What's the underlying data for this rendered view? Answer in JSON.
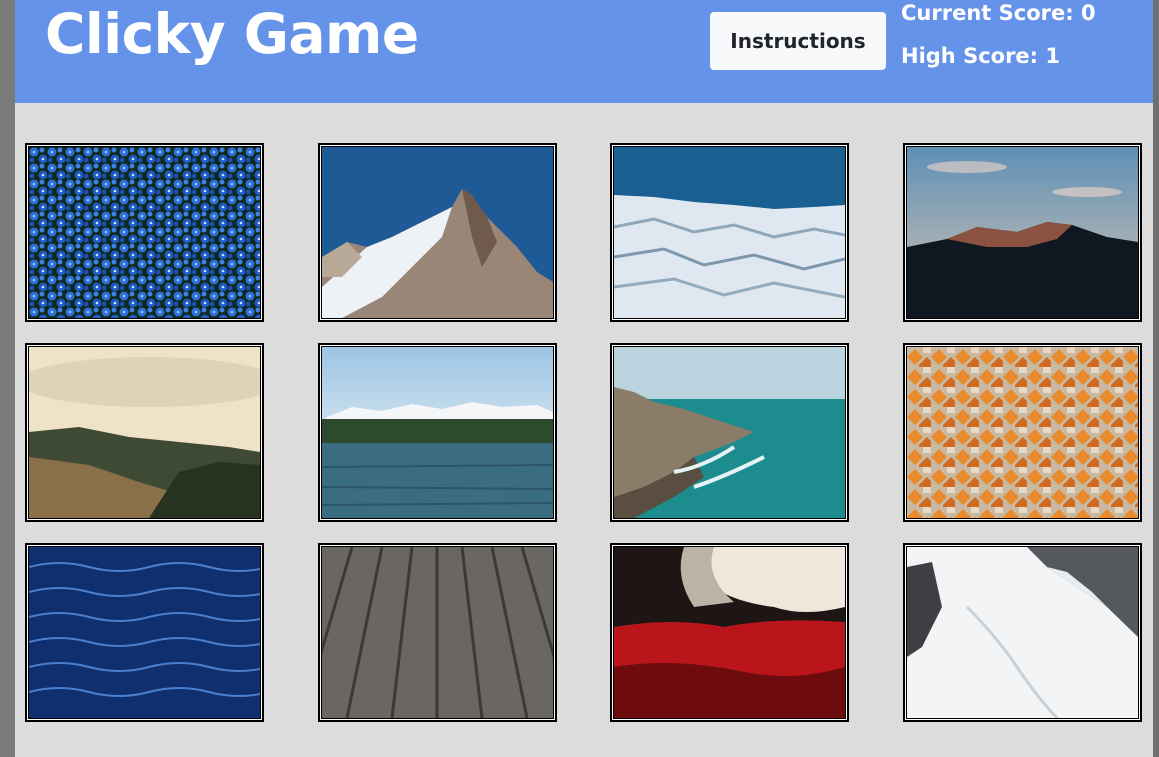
{
  "header": {
    "title": "Clicky Game",
    "instructions_label": "Instructions",
    "current_score_label": "Current Score:",
    "current_score": 0,
    "high_score_label": "High Score:",
    "high_score": 1
  },
  "colors": {
    "header_bg": "#6593e9",
    "page_bg": "#dcdcdc",
    "button_bg": "#f8f9fa"
  },
  "cards": [
    {
      "id": "card-1",
      "subject": "blue-flowers"
    },
    {
      "id": "card-2",
      "subject": "rocky-snow-peak"
    },
    {
      "id": "card-3",
      "subject": "glacier-ice"
    },
    {
      "id": "card-4",
      "subject": "mountain-ridge-dusk"
    },
    {
      "id": "card-5",
      "subject": "hazy-forest-hills"
    },
    {
      "id": "card-6",
      "subject": "lake-and-snowy-mountains"
    },
    {
      "id": "card-7",
      "subject": "rocky-coastline-sea"
    },
    {
      "id": "card-8",
      "subject": "orange-rooftops-city"
    },
    {
      "id": "card-9",
      "subject": "blue-water-ripples"
    },
    {
      "id": "card-10",
      "subject": "wooden-boardwalk"
    },
    {
      "id": "card-11",
      "subject": "red-white-reflection"
    },
    {
      "id": "card-12",
      "subject": "snowy-valley"
    }
  ]
}
